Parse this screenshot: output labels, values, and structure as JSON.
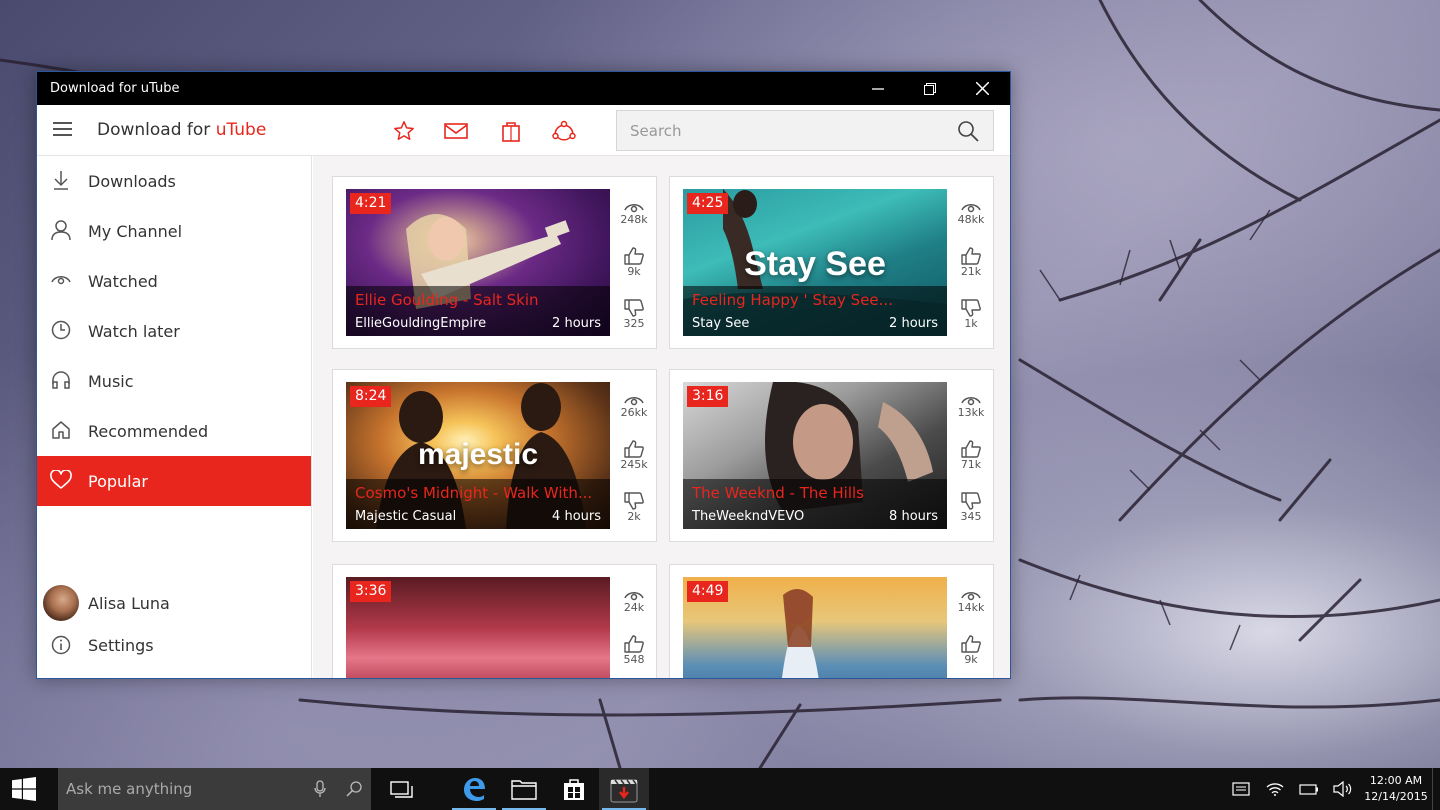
{
  "window": {
    "title": "Download for uTube",
    "controls": [
      "minimize-icon",
      "restore-icon",
      "close-icon"
    ]
  },
  "appbar": {
    "title_prefix": "Download for ",
    "title_accent": "uTube",
    "toolbar_icons": [
      "star-icon",
      "mail-icon",
      "store-bag-icon",
      "share-icon"
    ],
    "search_placeholder": "Search",
    "search_value": "",
    "accent_color": "#e8261d"
  },
  "sidebar": {
    "items": [
      {
        "label": "Downloads",
        "icon": "download-icon"
      },
      {
        "label": "My Channel",
        "icon": "person-icon"
      },
      {
        "label": "Watched",
        "icon": "eye-icon"
      },
      {
        "label": "Watch later",
        "icon": "clock-icon"
      },
      {
        "label": "Music",
        "icon": "headphones-icon"
      },
      {
        "label": "Recommended",
        "icon": "home-icon"
      },
      {
        "label": "Popular",
        "icon": "heart-icon",
        "active": true
      }
    ],
    "user": {
      "name": "Alisa Luna"
    },
    "settings_label": "Settings"
  },
  "videos": [
    {
      "duration": "4:21",
      "title": "Ellie Goulding - Salt Skin",
      "channel": "EllieGouldingEmpire",
      "age": "2 hours",
      "views": "248k",
      "likes": "9k",
      "dislikes": "325"
    },
    {
      "duration": "4:25",
      "title": "Feeling Happy ' Stay See...",
      "channel": "Stay See",
      "age": "2 hours",
      "views": "48kk",
      "likes": "21k",
      "dislikes": "1k",
      "overlay_text": "Stay See"
    },
    {
      "duration": "8:24",
      "title": "Cosmo's Midnight - Walk With...",
      "channel": "Majestic Casual",
      "age": "4 hours",
      "views": "26kk",
      "likes": "245k",
      "dislikes": "2k",
      "overlay_text": "majestic"
    },
    {
      "duration": "3:16",
      "title": "The Weeknd - The Hills",
      "channel": "TheWeekndVEVO",
      "age": "8 hours",
      "views": "13kk",
      "likes": "71k",
      "dislikes": "345"
    },
    {
      "duration": "3:36",
      "views": "24k",
      "likes": "548"
    },
    {
      "duration": "4:49",
      "views": "14kk",
      "likes": "9k"
    }
  ],
  "taskbar": {
    "search_placeholder": "Ask me anything",
    "apps": [
      "task-view-icon",
      "edge-icon",
      "file-explorer-icon",
      "store-icon",
      "download-for-utube-icon"
    ],
    "tray_icons": [
      "action-center-icon",
      "wifi-icon",
      "battery-icon",
      "volume-icon"
    ],
    "time": "12:00 AM",
    "date": "12/14/2015"
  }
}
